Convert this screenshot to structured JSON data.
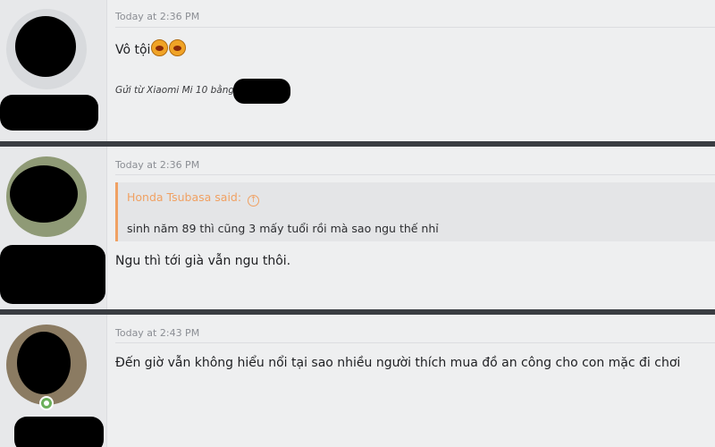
{
  "posts": [
    {
      "timestamp": "Today at 2:36 PM",
      "message": "Vô tội",
      "emoji": [
        "laughing-emoji",
        "laughing-emoji"
      ],
      "signature": "Gửi từ Xiaomi Mi 10 bằng"
    },
    {
      "timestamp": "Today at 2:36 PM",
      "quote": {
        "author": "Honda Tsubasa said:",
        "text": "sinh năm 89 thì cũng 3 mấy tuổi rồi mà sao ngu thế nhỉ"
      },
      "message": "Ngu thì tới già vẫn ngu thôi."
    },
    {
      "timestamp": "Today at 2:43 PM",
      "message": "Đến giờ vẫn không hiểu nổi tại sao nhiều người thích mua đồ an công cho con mặc đi chơi",
      "user_status": "online"
    }
  ],
  "colors": {
    "quote_accent": "#f0a163",
    "separator": "#3a3d42",
    "online": "#6cb05b"
  }
}
